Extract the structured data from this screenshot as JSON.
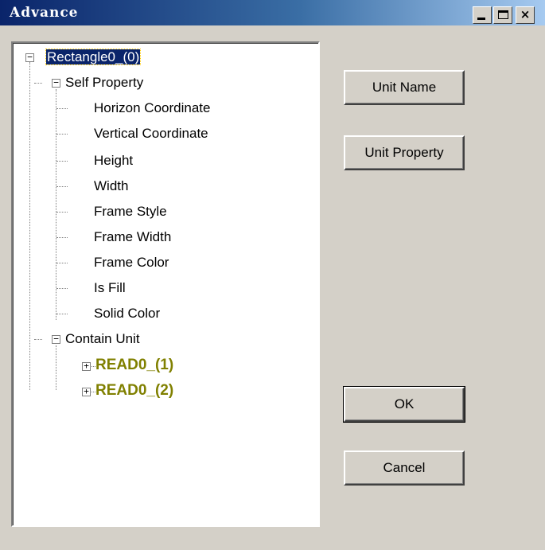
{
  "window": {
    "title": "Advance",
    "minimize_label": "_",
    "close_label": "×"
  },
  "tree": {
    "root": {
      "label": "Rectangle0_(0)",
      "expander": "−"
    },
    "self_property": {
      "label": "Self Property",
      "expander": "−",
      "items": [
        "Horizon Coordinate",
        "Vertical Coordinate",
        "Height",
        "Width",
        "Frame Style",
        "Frame Width",
        "Frame Color",
        "Is Fill",
        "Solid Color"
      ]
    },
    "contain_unit": {
      "label": "Contain Unit",
      "expander": "−",
      "units": [
        {
          "label": "READ0_(1)",
          "expander": "+"
        },
        {
          "label": "READ0_(2)",
          "expander": "+"
        }
      ]
    }
  },
  "buttons": {
    "unit_name": "Unit Name",
    "unit_property": "Unit Property",
    "ok": "OK",
    "cancel": "Cancel"
  },
  "colors": {
    "title_start": "#0a246a",
    "title_end": "#a6caf0",
    "face": "#d4d0c8",
    "unit_text": "#808000",
    "selection": "#0a246a"
  }
}
